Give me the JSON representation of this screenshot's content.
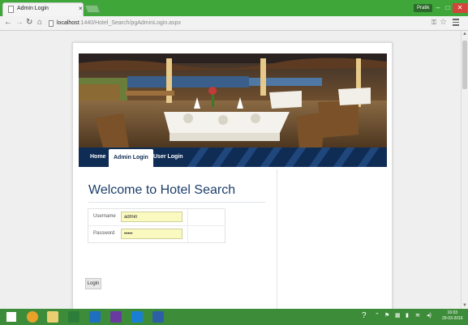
{
  "browser": {
    "tab_title": "Admin Login",
    "tab_close": "×",
    "profile": "Pratik",
    "win_min": "–",
    "win_max": "□",
    "win_close": "✕",
    "url_host": "localhost",
    "url_path": ":1440/Hotel_Search/pgAdminLogin.aspx"
  },
  "site_nav": {
    "items": [
      {
        "label": "Home"
      },
      {
        "label": "Admin Login",
        "active": true
      },
      {
        "label": "User Login"
      }
    ]
  },
  "page": {
    "heading": "Welcome to Hotel Search",
    "username_label": "Username",
    "username_value": "admin",
    "password_label": "Password",
    "password_value": "•••••",
    "login_button": "Login"
  },
  "taskbar": {
    "clock_time": "16:03",
    "clock_date": "29-03-2016"
  },
  "colors": {
    "titlebar": "#3fa63a",
    "nav_strip": "#0f2c55",
    "heading": "#1d3e6b",
    "field_bg": "#fafac0",
    "taskbar": "#3d8c3a"
  }
}
